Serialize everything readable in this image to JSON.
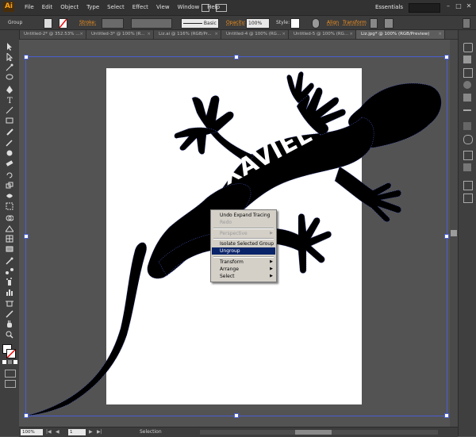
{
  "app": {
    "logo": "Ai",
    "workspace": "Essentials"
  },
  "menubar": {
    "items": [
      "File",
      "Edit",
      "Object",
      "Type",
      "Select",
      "Effect",
      "View",
      "Window",
      "Help"
    ]
  },
  "control_bar": {
    "selection_label": "Group",
    "stroke_label": "Stroke:",
    "brush_label": "Basic",
    "opacity_label": "Opacity:",
    "opacity_value": "100%",
    "style_label": "Style:",
    "align_label": "Align",
    "transform_label": "Transform"
  },
  "tabs": [
    {
      "label": "Untitled-2* @ 352.53% ...",
      "active": false
    },
    {
      "label": "Untitled-3* @ 100% (R...",
      "active": false
    },
    {
      "label": "Liz.ai @ 116% (RGB/Pr...",
      "active": false
    },
    {
      "label": "Untitled-4 @ 100% (RG...",
      "active": false
    },
    {
      "label": "Untitled-5 @ 100% (RG...",
      "active": false
    },
    {
      "label": "Liz.jpg* @ 100% (RGB/Preview)",
      "active": true
    }
  ],
  "artwork": {
    "text": "XAVIEL",
    "fill": "#000000",
    "text_fill": "#ffffff"
  },
  "context_menu": {
    "items": [
      {
        "label": "Undo Expand Tracing",
        "state": "normal"
      },
      {
        "label": "Redo",
        "state": "disabled"
      },
      {
        "label": "Perspective",
        "state": "disabled",
        "submenu": true
      },
      {
        "label": "Isolate Selected Group",
        "state": "normal"
      },
      {
        "label": "Ungroup",
        "state": "highlight"
      },
      {
        "label": "Transform",
        "state": "normal",
        "submenu": true
      },
      {
        "label": "Arrange",
        "state": "normal",
        "submenu": true
      },
      {
        "label": "Select",
        "state": "normal",
        "submenu": true
      }
    ]
  },
  "statusbar": {
    "zoom": "100%",
    "page": "1",
    "mode": "Selection"
  },
  "colors": {
    "selection": "#4a5ed3",
    "menu_highlight": "#0a246a",
    "accent": "#f7931e"
  }
}
